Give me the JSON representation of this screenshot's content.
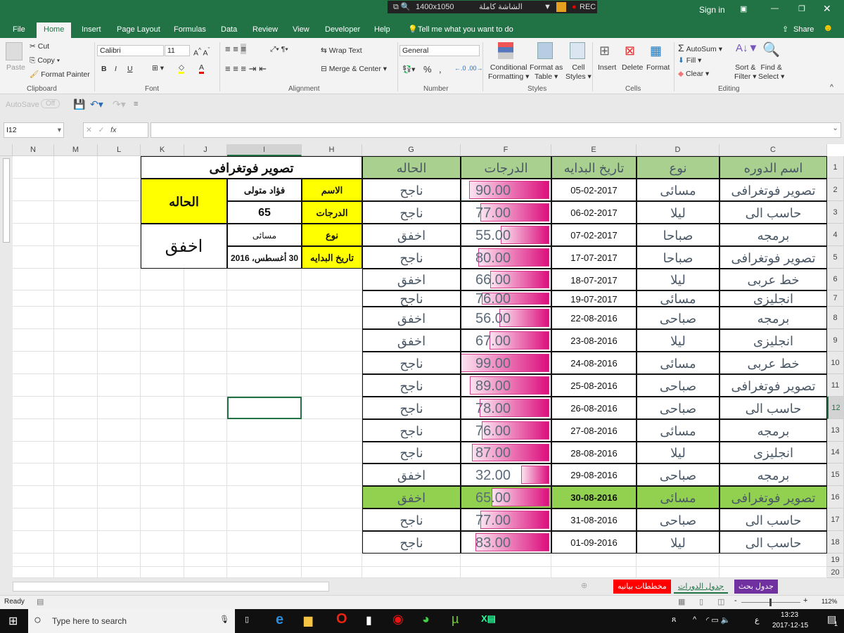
{
  "recorder": {
    "resolution": "1400x1050",
    "mode": "الشاشة كاملة",
    "rec": "REC"
  },
  "titlebar": {
    "sign_in": "Sign in"
  },
  "tabs": [
    "File",
    "Home",
    "Insert",
    "Page Layout",
    "Formulas",
    "Data",
    "Review",
    "View",
    "Developer",
    "Help"
  ],
  "tell_me": "Tell me what you want to do",
  "share": "Share",
  "ribbon": {
    "clipboard": {
      "paste": "Paste",
      "cut": "Cut",
      "copy": "Copy",
      "format_painter": "Format Painter",
      "label": "Clipboard"
    },
    "font": {
      "name": "Calibri",
      "size": "11",
      "bold": "B",
      "italic": "I",
      "underline": "U",
      "label": "Font"
    },
    "alignment": {
      "wrap": "Wrap Text",
      "merge": "Merge & Center",
      "label": "Alignment"
    },
    "number": {
      "format": "General",
      "percent": "%",
      "comma": ",",
      "label": "Number"
    },
    "styles": {
      "conditional": "Conditional",
      "conditional2": "Formatting",
      "format_as": "Format as",
      "table": "Table",
      "cell": "Cell",
      "styles": "Styles",
      "label": "Styles"
    },
    "cells": {
      "insert": "Insert",
      "delete": "Delete",
      "format": "Format",
      "label": "Cells"
    },
    "editing": {
      "autosum": "AutoSum",
      "fill": "Fill",
      "clear": "Clear",
      "sort": "Sort &",
      "filter": "Filter",
      "find": "Find &",
      "select": "Select",
      "label": "Editing"
    }
  },
  "qat": {
    "autosave": "AutoSave",
    "off": "Off"
  },
  "formula_bar": {
    "name_box": "I12",
    "fx": "fx",
    "value": ""
  },
  "columns": [
    "N",
    "M",
    "L",
    "K",
    "J",
    "I",
    "H",
    "G",
    "F",
    "E",
    "D",
    "C"
  ],
  "selected_column": "I",
  "selected_row": 12,
  "selected_cell": "I12",
  "table": {
    "headers": {
      "course": "اسم الدوره",
      "type": "نوع",
      "start": "تاريخ البدايه",
      "grade": "الدرجات",
      "status": "الحاله"
    },
    "rows": [
      {
        "course": "تصوير فوتغرافى",
        "type": "مسائى",
        "start": "05-02-2017",
        "grade": "90.00",
        "status": "ناجح"
      },
      {
        "course": "حاسب الى",
        "type": "ليلا",
        "start": "06-02-2017",
        "grade": "77.00",
        "status": "ناجح"
      },
      {
        "course": "برمجه",
        "type": "صباحا",
        "start": "07-02-2017",
        "grade": "55.00",
        "status": "اخفق"
      },
      {
        "course": "تصوير فوتغرافى",
        "type": "صباحا",
        "start": "17-07-2017",
        "grade": "80.00",
        "status": "ناجح"
      },
      {
        "course": "خط عربى",
        "type": "ليلا",
        "start": "18-07-2017",
        "grade": "66.00",
        "status": "اخفق"
      },
      {
        "course": "انجليزى",
        "type": "مسائى",
        "start": "19-07-2017",
        "grade": "76.00",
        "status": "ناجح"
      },
      {
        "course": "برمجه",
        "type": "صباحى",
        "start": "22-08-2016",
        "grade": "56.00",
        "status": "اخفق"
      },
      {
        "course": "انجليزى",
        "type": "ليلا",
        "start": "23-08-2016",
        "grade": "67.00",
        "status": "اخفق"
      },
      {
        "course": "خط عربى",
        "type": "مسائى",
        "start": "24-08-2016",
        "grade": "99.00",
        "status": "ناجح"
      },
      {
        "course": "تصوير فوتغرافى",
        "type": "صباحى",
        "start": "25-08-2016",
        "grade": "89.00",
        "status": "ناجح"
      },
      {
        "course": "حاسب الى",
        "type": "صباحى",
        "start": "26-08-2016",
        "grade": "78.00",
        "status": "ناجح"
      },
      {
        "course": "برمجه",
        "type": "مسائى",
        "start": "27-08-2016",
        "grade": "76.00",
        "status": "ناجح"
      },
      {
        "course": "انجليزى",
        "type": "ليلا",
        "start": "28-08-2016",
        "grade": "87.00",
        "status": "ناجح"
      },
      {
        "course": "برمجه",
        "type": "صباحى",
        "start": "29-08-2016",
        "grade": "32.00",
        "status": "اخفق"
      },
      {
        "course": "تصوير فوتغرافى",
        "type": "مسائى",
        "start": "30-08-2016",
        "grade": "65.00",
        "status": "اخفق",
        "highlight": true
      },
      {
        "course": "حاسب الى",
        "type": "صباحى",
        "start": "31-08-2016",
        "grade": "77.00",
        "status": "ناجح"
      },
      {
        "course": "حاسب الى",
        "type": "ليلا",
        "start": "01-09-2016",
        "grade": "83.00",
        "status": "ناجح"
      }
    ]
  },
  "lookup": {
    "title": "تصوير فوتغرافى",
    "name_label": "الاسم",
    "name_value": "فؤاد متولى",
    "grade_label": "الدرجات",
    "grade_value": "65",
    "type_label": "نوع",
    "type_value": "مسائى",
    "start_label": "تاريخ البدايه",
    "start_value": "30 أغسطس، 2016",
    "status_label": "الحاله",
    "status_value": "اخفق"
  },
  "colors": {
    "excel_green": "#217346",
    "header_green": "#a9d08e",
    "highlight_green": "#92d050",
    "yellow": "#ffff00",
    "bar": "#dc0f7d"
  },
  "sheet_tabs": [
    {
      "label": "مخططات بيانيه",
      "color": "#ff0000"
    },
    {
      "label": "جدول الدورات",
      "color": "#e9e9e9",
      "active": true
    },
    {
      "label": "جدول بحث",
      "color": "#7030a0"
    }
  ],
  "status": {
    "ready": "Ready",
    "zoom": "112%",
    "zoom_percent": 112
  },
  "taskbar": {
    "search": "Type here to search",
    "time": "13:23",
    "date": "2017-12-15",
    "lang": "ع",
    "notifications": "1"
  }
}
